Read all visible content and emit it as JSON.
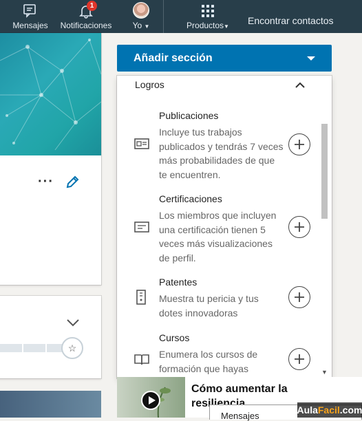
{
  "topnav": {
    "messages": "Mensajes",
    "notifications": "Notificaciones",
    "notif_count": "1",
    "me": "Yo",
    "products": "Productos",
    "find_contacts": "Encontrar contactos"
  },
  "add_section_label": "Añadir sección",
  "panel": {
    "title": "Logros",
    "sections": [
      {
        "title": "Publicaciones",
        "desc": "Incluye tus trabajos publicados y tendrás 7 veces más probabilidades de que te encuentren.",
        "icon": "publication-icon"
      },
      {
        "title": "Certificaciones",
        "desc": "Los miembros que incluyen una certificación tienen 5 veces más visualizaciones de perfil.",
        "icon": "certificate-icon"
      },
      {
        "title": "Patentes",
        "desc": "Muestra tu pericia y tus dotes innovadoras",
        "icon": "patent-icon"
      },
      {
        "title": "Cursos",
        "desc": "Enumera los cursos de formación que hayas",
        "icon": "book-icon"
      }
    ]
  },
  "article_title": "Cómo aumentar la resiliencia",
  "message_box": "Mensajes",
  "watermark_a": "Aula",
  "watermark_b": "Facil",
  "watermark_c": ".com",
  "colors": {
    "nav": "#283e4a",
    "accent": "#0073b1"
  }
}
